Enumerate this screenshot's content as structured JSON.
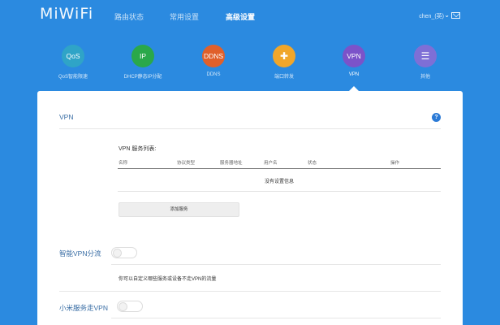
{
  "header": {
    "logo": "MiWiFi",
    "nav": [
      "路由状态",
      "常用设置",
      "高级设置"
    ],
    "active_nav": "高级设置",
    "user": "chen_(英)"
  },
  "features": [
    {
      "icon_text": "QoS",
      "label": "QoS智能限速",
      "color": "#2fa4c7",
      "icon": "qos-icon"
    },
    {
      "icon_text": "IP",
      "label": "DHCP静态IP分配",
      "color": "#2aa84a",
      "icon": "ip-icon"
    },
    {
      "icon_text": "DDNS",
      "label": "DDNS",
      "color": "#e0602b",
      "icon": "ddns-icon"
    },
    {
      "icon_text": "✚",
      "label": "端口转发",
      "color": "#f0a62a",
      "icon": "port-forward-icon"
    },
    {
      "icon_text": "VPN",
      "label": "VPN",
      "color": "#7b53c9",
      "icon": "vpn-icon"
    },
    {
      "icon_text": "☰",
      "label": "其他",
      "color": "#7e6fd6",
      "icon": "more-icon"
    }
  ],
  "vpn": {
    "title": "VPN",
    "help": "?",
    "list_title": "VPN 服务列表:",
    "columns": [
      "名称",
      "协议类型",
      "服务器地址",
      "用户名",
      "状态",
      "操作"
    ],
    "empty_text": "没有设置信息",
    "add_button": "添加服务"
  },
  "smart_vpn": {
    "title": "智能VPN分流",
    "description": "你可以自定义哪些服务或设备不走VPN的流量"
  },
  "mi_vpn": {
    "title": "小米服务走VPN"
  }
}
